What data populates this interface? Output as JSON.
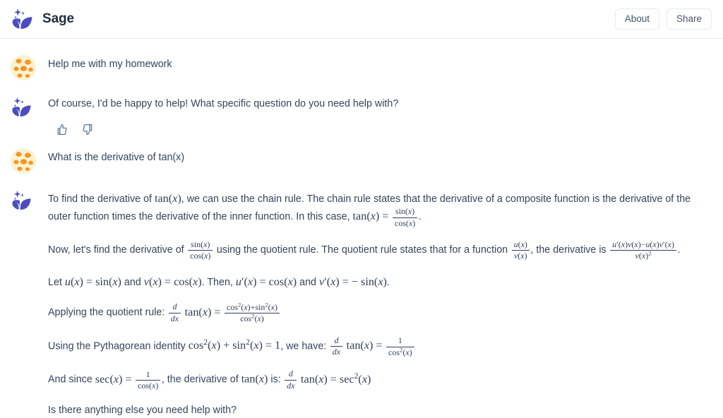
{
  "header": {
    "title": "Sage",
    "logo_icon": "sparkle-leaf-logo",
    "about_label": "About",
    "share_label": "Share"
  },
  "conversation": [
    {
      "role": "user",
      "avatar_icon": "user-avatar-spotted-circle",
      "text": "Help me with my homework"
    },
    {
      "role": "assistant",
      "avatar_icon": "sparkle-leaf-logo",
      "text": "Of course, I'd be happy to help! What specific question do you need help with?",
      "feedback": {
        "thumbs_up_icon": "thumbs-up-icon",
        "thumbs_down_icon": "thumbs-down-icon"
      }
    },
    {
      "role": "user",
      "avatar_icon": "user-avatar-spotted-circle",
      "text": "What is the derivative of tan(x)"
    },
    {
      "role": "assistant",
      "avatar_icon": "sparkle-leaf-logo",
      "paragraphs": {
        "p1_a": "To find the derivative of ",
        "p1_b": ", we can use the chain rule. The chain rule states that the derivative of a composite function is the derivative of the outer function times the derivative of the inner function. In this case, ",
        "p1_c": ".",
        "p2_a": "Now, let's find the derivative of ",
        "p2_b": " using the quotient rule. The quotient rule states that for a function ",
        "p2_c": ", the derivative is ",
        "p2_d": ".",
        "p3": "Let u(x) = sin(x) and v(x) = cos(x). Then, u'(x) = cos(x) and v'(x) = - sin(x).",
        "p4_a": "Applying the quotient rule: ",
        "p5_a": "Using the Pythagorean identity ",
        "p5_b": ", we have: ",
        "p6_a": "And since ",
        "p6_b": ", the derivative of ",
        "p6_c": " is: ",
        "p7": "Is there anything else you need help with?"
      },
      "math": {
        "tan_x": "tan(x)",
        "tan_identity": "tan(x) = sin(x)/cos(x)",
        "sin_over_cos": "sin(x)/cos(x)",
        "u_over_v": "u(x)/v(x)",
        "quotient_rule": "(u'(x)v(x)-u(x)v'(x))/v(x)^2",
        "let_u": "u(x) = sin(x)",
        "let_v": "v(x) = cos(x)",
        "u_prime": "u'(x) = cos(x)",
        "v_prime": "v'(x) = - sin(x)",
        "applying": "d/dx tan(x) = (cos^2(x)+sin^2(x))/cos^2(x)",
        "pythagorean": "cos^2(x) + sin^2(x) = 1",
        "result_1": "d/dx tan(x) = 1/cos^2(x)",
        "sec_def": "sec(x) = 1/cos(x)",
        "result_final": "d/dx tan(x) = sec^2(x)",
        "labels": {
          "let": "Let",
          "and": "and",
          "then": "Then,",
          "period": "."
        }
      }
    }
  ],
  "colors": {
    "brand_purple": "#4b4cbf",
    "text": "#33455e",
    "heading": "#1f2d3d",
    "border": "#e6eef5",
    "icon_slate": "#5f7899",
    "avatar_base": "#f7f0cf",
    "avatar_spot": "#f79520"
  }
}
